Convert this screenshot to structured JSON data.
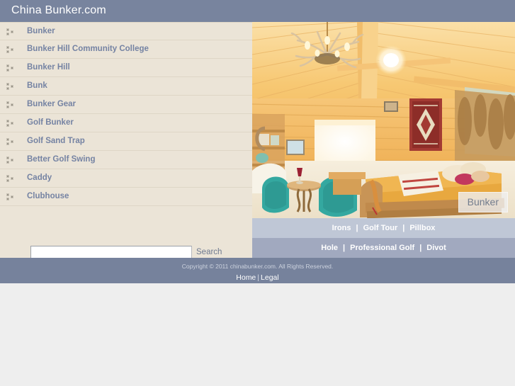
{
  "header": {
    "title": "China Bunker.com",
    "background": "#78849e"
  },
  "sidebar": {
    "background": "#ebe4d7",
    "icon": "list-bullet-icon",
    "items": [
      {
        "label": "Bunker"
      },
      {
        "label": "Bunker Hill Community College"
      },
      {
        "label": "Bunker Hill"
      },
      {
        "label": "Bunk"
      },
      {
        "label": "Bunker Gear"
      },
      {
        "label": "Golf Bunker"
      },
      {
        "label": "Golf Sand Trap"
      },
      {
        "label": "Better Golf Swing"
      },
      {
        "label": "Caddy"
      },
      {
        "label": "Clubhouse"
      }
    ]
  },
  "search": {
    "value": "",
    "placeholder": "",
    "button_label": "Search"
  },
  "photo": {
    "alt": "log cabin bedroom interior with antler chandelier",
    "badge_label": "Bunker"
  },
  "link_bars": [
    {
      "name": "upper",
      "background": "#bfc7d6",
      "items": [
        "Irons",
        "Golf Tour",
        "Pillbox"
      ],
      "separator": "|"
    },
    {
      "name": "lower",
      "background": "#a1a9bf",
      "items": [
        "Hole",
        "Professional Golf",
        "Divot"
      ],
      "separator": "|"
    }
  ],
  "footer": {
    "background": "#76829c",
    "copyright": "Copyright © 2011 chinabunker.com. All Rights Reserved.",
    "links": [
      "Home",
      "Legal"
    ],
    "separator": "|"
  }
}
